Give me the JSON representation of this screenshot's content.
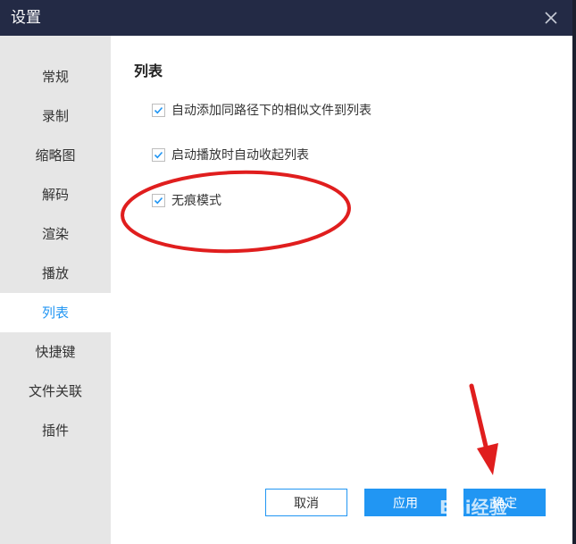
{
  "window": {
    "title": "设置"
  },
  "sidebar": {
    "items": [
      {
        "label": "常规"
      },
      {
        "label": "录制"
      },
      {
        "label": "缩略图"
      },
      {
        "label": "解码"
      },
      {
        "label": "渲染"
      },
      {
        "label": "播放"
      },
      {
        "label": "列表",
        "active": true
      },
      {
        "label": "快捷键"
      },
      {
        "label": "文件关联"
      },
      {
        "label": "插件"
      }
    ]
  },
  "main": {
    "section_title": "列表",
    "options": [
      {
        "label": "自动添加同路径下的相似文件到列表",
        "checked": true
      },
      {
        "label": "启动播放时自动收起列表",
        "checked": true
      },
      {
        "label": "无痕模式",
        "checked": true
      }
    ]
  },
  "buttons": {
    "cancel": "取消",
    "apply": "应用",
    "ok": "确定"
  },
  "watermark": "Bai经验",
  "colors": {
    "titlebar": "#232a45",
    "accent": "#2196f3",
    "sidebar_bg": "#e6e6e6",
    "annotation": "#e01e1e"
  }
}
